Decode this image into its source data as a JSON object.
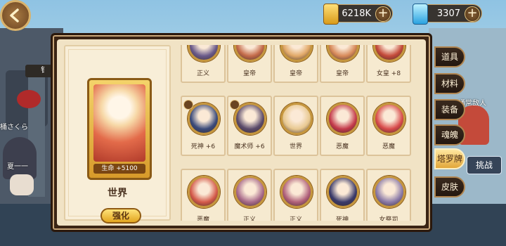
{
  "top": {
    "gold": "6218K",
    "gems": "3307",
    "plus": "+"
  },
  "scene": {
    "name_left_1": "桶さくら",
    "name_left_2": "夏一一",
    "name_right": "通常敌人",
    "sign_left": "钅"
  },
  "detail": {
    "card_hp": "生命 +5100",
    "card_name": "世界",
    "upgrade_label": "强化"
  },
  "cards": [
    {
      "label": "正义",
      "color": "#6a5a8a"
    },
    {
      "label": "皇帝",
      "color": "#c46b4a"
    },
    {
      "label": "皇帝",
      "color": "#e1a867"
    },
    {
      "label": "皇帝",
      "color": "#d88a5a"
    },
    {
      "label": "女皇 +8",
      "color": "#c44a3a"
    },
    {
      "label": "死神 +6",
      "color": "#3a4a7a"
    },
    {
      "label": "魔术师 +6",
      "color": "#5a4a6a"
    },
    {
      "label": "世界",
      "color": "#e8c890"
    },
    {
      "label": "恶魔",
      "color": "#c43a4a"
    },
    {
      "label": "恶魔",
      "color": "#d84a4a"
    },
    {
      "label": "恶魔",
      "color": "#d45a4a"
    },
    {
      "label": "正义",
      "color": "#a86a8a"
    },
    {
      "label": "正义",
      "color": "#b0607a"
    },
    {
      "label": "死神",
      "color": "#3a3a6a"
    },
    {
      "label": "女祭司",
      "color": "#8a7aa8"
    }
  ],
  "tabs": [
    {
      "label": "道具"
    },
    {
      "label": "材料"
    },
    {
      "label": "装备"
    },
    {
      "label": "魂魄"
    },
    {
      "label": "塔罗牌"
    },
    {
      "label": "皮肤"
    }
  ],
  "challenge": "挑战"
}
